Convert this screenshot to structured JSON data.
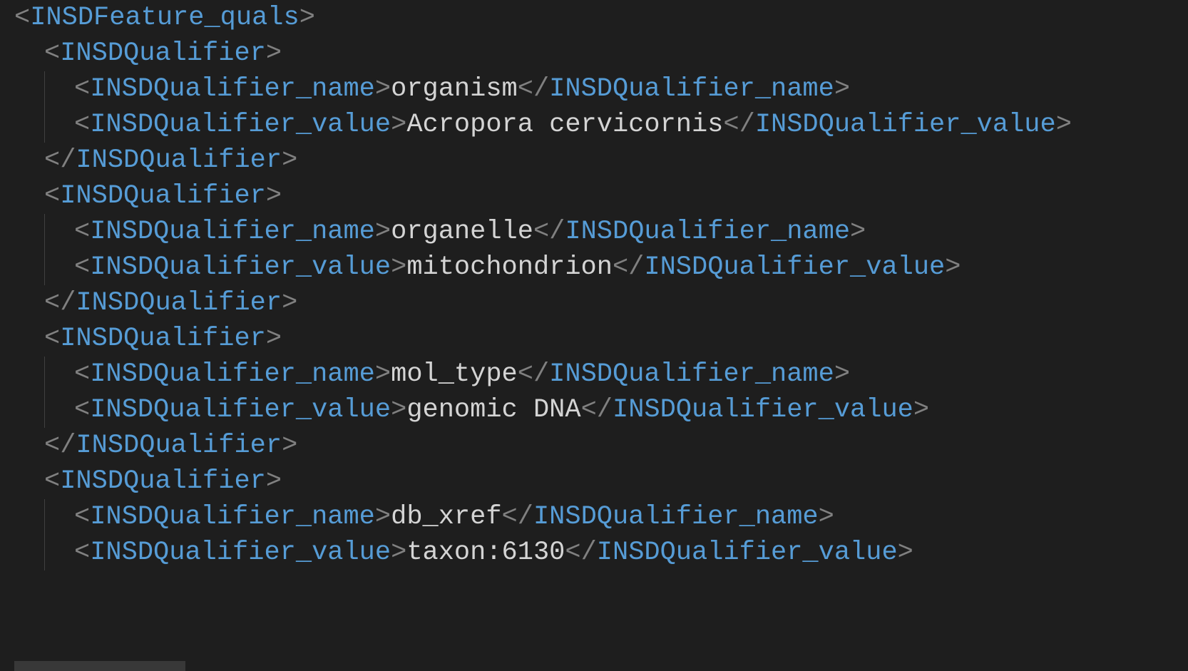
{
  "lines": [
    {
      "indent": 0,
      "parts": [
        {
          "c": "b",
          "t": "<"
        },
        {
          "c": "t",
          "t": "INSDFeature_quals"
        },
        {
          "c": "b",
          "t": ">"
        }
      ]
    },
    {
      "indent": 1,
      "parts": [
        {
          "c": "b",
          "t": "<"
        },
        {
          "c": "t",
          "t": "INSDQualifier"
        },
        {
          "c": "b",
          "t": ">"
        }
      ]
    },
    {
      "indent": 2,
      "parts": [
        {
          "c": "b",
          "t": "<"
        },
        {
          "c": "t",
          "t": "INSDQualifier_name"
        },
        {
          "c": "b",
          "t": ">"
        },
        {
          "c": "tx",
          "t": "organism"
        },
        {
          "c": "b",
          "t": "</"
        },
        {
          "c": "t",
          "t": "INSDQualifier_name"
        },
        {
          "c": "b",
          "t": ">"
        }
      ]
    },
    {
      "indent": 2,
      "parts": [
        {
          "c": "b",
          "t": "<"
        },
        {
          "c": "t",
          "t": "INSDQualifier_value"
        },
        {
          "c": "b",
          "t": ">"
        },
        {
          "c": "tx",
          "t": "Acropora cervicornis"
        },
        {
          "c": "b",
          "t": "</"
        },
        {
          "c": "t",
          "t": "INSDQualifier_value"
        },
        {
          "c": "b",
          "t": ">"
        }
      ]
    },
    {
      "indent": 1,
      "parts": [
        {
          "c": "b",
          "t": "</"
        },
        {
          "c": "t",
          "t": "INSDQualifier"
        },
        {
          "c": "b",
          "t": ">"
        }
      ]
    },
    {
      "indent": 1,
      "parts": [
        {
          "c": "b",
          "t": "<"
        },
        {
          "c": "t",
          "t": "INSDQualifier"
        },
        {
          "c": "b",
          "t": ">"
        }
      ]
    },
    {
      "indent": 2,
      "parts": [
        {
          "c": "b",
          "t": "<"
        },
        {
          "c": "t",
          "t": "INSDQualifier_name"
        },
        {
          "c": "b",
          "t": ">"
        },
        {
          "c": "tx",
          "t": "organelle"
        },
        {
          "c": "b",
          "t": "</"
        },
        {
          "c": "t",
          "t": "INSDQualifier_name"
        },
        {
          "c": "b",
          "t": ">"
        }
      ]
    },
    {
      "indent": 2,
      "parts": [
        {
          "c": "b",
          "t": "<"
        },
        {
          "c": "t",
          "t": "INSDQualifier_value"
        },
        {
          "c": "b",
          "t": ">"
        },
        {
          "c": "tx",
          "t": "mitochondrion"
        },
        {
          "c": "b",
          "t": "</"
        },
        {
          "c": "t",
          "t": "INSDQualifier_value"
        },
        {
          "c": "b",
          "t": ">"
        }
      ]
    },
    {
      "indent": 1,
      "parts": [
        {
          "c": "b",
          "t": "</"
        },
        {
          "c": "t",
          "t": "INSDQualifier"
        },
        {
          "c": "b",
          "t": ">"
        }
      ]
    },
    {
      "indent": 1,
      "parts": [
        {
          "c": "b",
          "t": "<"
        },
        {
          "c": "t",
          "t": "INSDQualifier"
        },
        {
          "c": "b",
          "t": ">"
        }
      ]
    },
    {
      "indent": 2,
      "parts": [
        {
          "c": "b",
          "t": "<"
        },
        {
          "c": "t",
          "t": "INSDQualifier_name"
        },
        {
          "c": "b",
          "t": ">"
        },
        {
          "c": "tx",
          "t": "mol_type"
        },
        {
          "c": "b",
          "t": "</"
        },
        {
          "c": "t",
          "t": "INSDQualifier_name"
        },
        {
          "c": "b",
          "t": ">"
        }
      ]
    },
    {
      "indent": 2,
      "parts": [
        {
          "c": "b",
          "t": "<"
        },
        {
          "c": "t",
          "t": "INSDQualifier_value"
        },
        {
          "c": "b",
          "t": ">"
        },
        {
          "c": "tx",
          "t": "genomic DNA"
        },
        {
          "c": "b",
          "t": "</"
        },
        {
          "c": "t",
          "t": "INSDQualifier_value"
        },
        {
          "c": "b",
          "t": ">"
        }
      ]
    },
    {
      "indent": 1,
      "parts": [
        {
          "c": "b",
          "t": "</"
        },
        {
          "c": "t",
          "t": "INSDQualifier"
        },
        {
          "c": "b",
          "t": ">"
        }
      ]
    },
    {
      "indent": 1,
      "parts": [
        {
          "c": "b",
          "t": "<"
        },
        {
          "c": "t",
          "t": "INSDQualifier"
        },
        {
          "c": "b",
          "t": ">"
        }
      ]
    },
    {
      "indent": 2,
      "parts": [
        {
          "c": "b",
          "t": "<"
        },
        {
          "c": "t",
          "t": "INSDQualifier_name"
        },
        {
          "c": "b",
          "t": ">"
        },
        {
          "c": "tx",
          "t": "db_xref"
        },
        {
          "c": "b",
          "t": "</"
        },
        {
          "c": "t",
          "t": "INSDQualifier_name"
        },
        {
          "c": "b",
          "t": ">"
        }
      ]
    },
    {
      "indent": 2,
      "parts": [
        {
          "c": "b",
          "t": "<"
        },
        {
          "c": "t",
          "t": "INSDQualifier_value"
        },
        {
          "c": "b",
          "t": ">"
        },
        {
          "c": "tx",
          "t": "taxon:6130"
        },
        {
          "c": "b",
          "t": "</"
        },
        {
          "c": "t",
          "t": "INSDQualifier_value"
        },
        {
          "c": "b",
          "t": ">"
        }
      ]
    }
  ]
}
